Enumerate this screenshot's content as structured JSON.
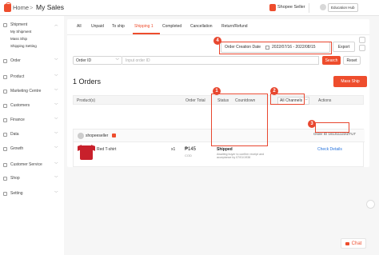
{
  "header": {
    "home": "Home",
    "separator": ">",
    "current": "My Sales",
    "seller_center": "Shopee Seller",
    "account": "Education Hub"
  },
  "sidebar": {
    "groups": [
      {
        "label": "Shipment",
        "sub": [
          "My Shipment",
          "Mass Ship",
          "Shipping Setting"
        ]
      },
      {
        "label": "Order"
      },
      {
        "label": "Product"
      },
      {
        "label": "Marketing Centre"
      },
      {
        "label": "Customers"
      },
      {
        "label": "Finance"
      },
      {
        "label": "Data"
      },
      {
        "label": "Growth"
      },
      {
        "label": "Customer Service"
      },
      {
        "label": "Shop"
      },
      {
        "label": "Setting"
      }
    ]
  },
  "tabs": [
    "All",
    "Unpaid",
    "To ship",
    "Shipping 1",
    "Completed",
    "Cancellation",
    "Return/Refund"
  ],
  "active_tab": "Shipping 1",
  "filters": {
    "date_label": "Order Creation Date",
    "date_range": "2022/07/16 - 2022/08/15",
    "export": "Export",
    "order_field": "Order ID",
    "search_placeholder": "Input order ID",
    "search": "Search",
    "reset": "Reset"
  },
  "orders": {
    "count_label": "1 Orders",
    "mass_ship": "Mass Ship",
    "columns": {
      "product": "Product(s)",
      "total": "Order Total",
      "status": "Status",
      "countdown": "Countdown",
      "channels": "All Channels",
      "actions": "Actions"
    },
    "rows": [
      {
        "buyer": "shopeeseller",
        "order_id": "Order ID 161311122IZTUT",
        "product": "Red T-shirt",
        "qty": "x1",
        "price": "₱145",
        "payment": "COD",
        "status": "Shipped",
        "status_desc": "Awaiting buyer to confirm receipt and acceptance by 07/01/1938",
        "action": "Check Details"
      }
    ]
  },
  "annotations": [
    "1",
    "2",
    "3",
    "4"
  ],
  "chat": "Chat",
  "colors": {
    "brand": "#ee4d2d",
    "annotation": "#e8472f",
    "link": "#2673dd"
  }
}
